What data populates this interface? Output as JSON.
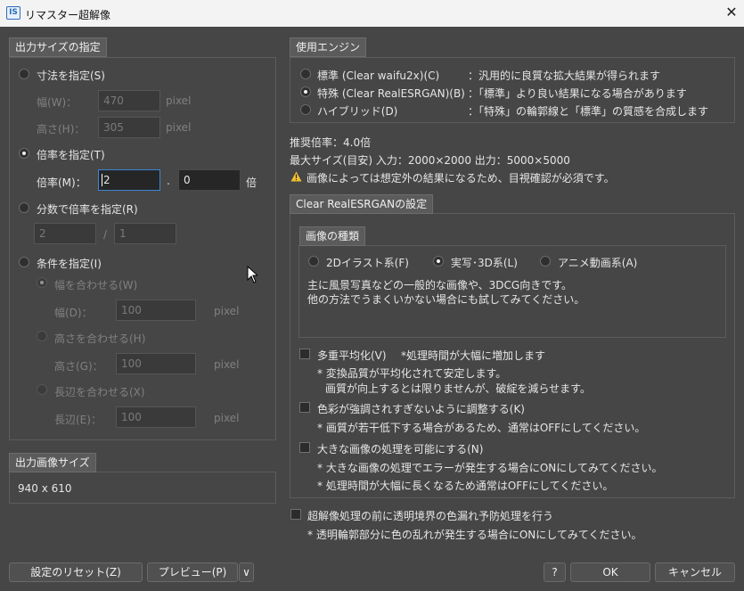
{
  "window": {
    "title": "リマスター超解像",
    "icon": "IS",
    "close_glyph": "✕"
  },
  "size_panel": {
    "header": "出力サイズの指定",
    "by_dimensions": {
      "label": "寸法を指定(S)",
      "width_label": "幅(W)：",
      "width_value": "470",
      "height_label": "高さ(H)：",
      "height_value": "305",
      "unit": "pixel"
    },
    "by_ratio": {
      "label": "倍率を指定(T)",
      "ratio_label": "倍率(M)：",
      "int_value": "2",
      "dot": ".",
      "dec_value": "0",
      "unit": "倍"
    },
    "by_fraction": {
      "label": "分数で倍率を指定(R)",
      "num_value": "2",
      "slash": "/",
      "den_value": "1"
    },
    "by_condition": {
      "label": "条件を指定(I)",
      "fit_width": {
        "label": "幅を合わせる(W)",
        "field_label": "幅(D)：",
        "value": "100",
        "unit": "pixel"
      },
      "fit_height": {
        "label": "高さを合わせる(H)",
        "field_label": "高さ(G)：",
        "value": "100",
        "unit": "pixel"
      },
      "fit_long": {
        "label": "長辺を合わせる(X)",
        "field_label": "長辺(E)：",
        "value": "100",
        "unit": "pixel"
      }
    }
  },
  "output_panel": {
    "header": "出力画像サイズ",
    "value": "940 x 610"
  },
  "engine_panel": {
    "header": "使用エンジン",
    "options": [
      {
        "label": "標準 (Clear waifu2x)(C)",
        "desc": "：汎用的に良質な拡大結果が得られます",
        "selected": false
      },
      {
        "label": "特殊 (Clear RealESRGAN)(B)",
        "desc": "：「標準」より良い結果になる場合があります",
        "selected": true
      },
      {
        "label": "ハイブリッド(D)",
        "desc": "：「特殊」の輪郭線と「標準」の質感を合成します",
        "selected": false
      }
    ]
  },
  "info": {
    "recommended": "推奨倍率：4.0倍",
    "max_size": "最大サイズ(目安) 入力：2000×2000 出力：5000×5000",
    "warning": "画像によっては想定外の結果になるため、目視確認が必須です。",
    "warning_icon": "warning-icon"
  },
  "esrgan_panel": {
    "header": "Clear RealESRGANの設定",
    "image_type": {
      "header": "画像の種類",
      "options": [
        {
          "label": "2Dイラスト系(F)",
          "selected": false
        },
        {
          "label": "実写･3D系(L)",
          "selected": true
        },
        {
          "label": "アニメ動画系(A)",
          "selected": false
        }
      ],
      "desc1": "主に風景写真などの一般的な画像や、3DCG向きです。",
      "desc2": "他の方法でうまくいかない場合にも試してみてください。"
    },
    "multi_avg": {
      "label": "多重平均化(V)",
      "note": "*処理時間が大幅に増加します",
      "sub1": "* 変換品質が平均化されて安定します。",
      "sub2": "画質が向上するとは限りませんが、破綻を減らせます。"
    },
    "color_adjust": {
      "label": "色彩が強調されすぎないように調整する(K)",
      "sub1": "* 画質が若干低下する場合があるため、通常はOFFにしてください。"
    },
    "large_image": {
      "label": "大きな画像の処理を可能にする(N)",
      "sub1": "* 大きな画像の処理でエラーが発生する場合にONにしてみてください。",
      "sub2": "* 処理時間が大幅に長くなるため通常はOFFにしてください。"
    }
  },
  "transparency": {
    "label": "超解像処理の前に透明境界の色漏れ予防処理を行う",
    "sub1": "* 透明輪郭部分に色の乱れが発生する場合にONにしてみてください。"
  },
  "buttons": {
    "reset": "設定のリセット(Z)",
    "preview": "プレビュー(P)",
    "preview_menu": "∨",
    "help": "?",
    "ok": "OK",
    "cancel": "キャンセル"
  }
}
